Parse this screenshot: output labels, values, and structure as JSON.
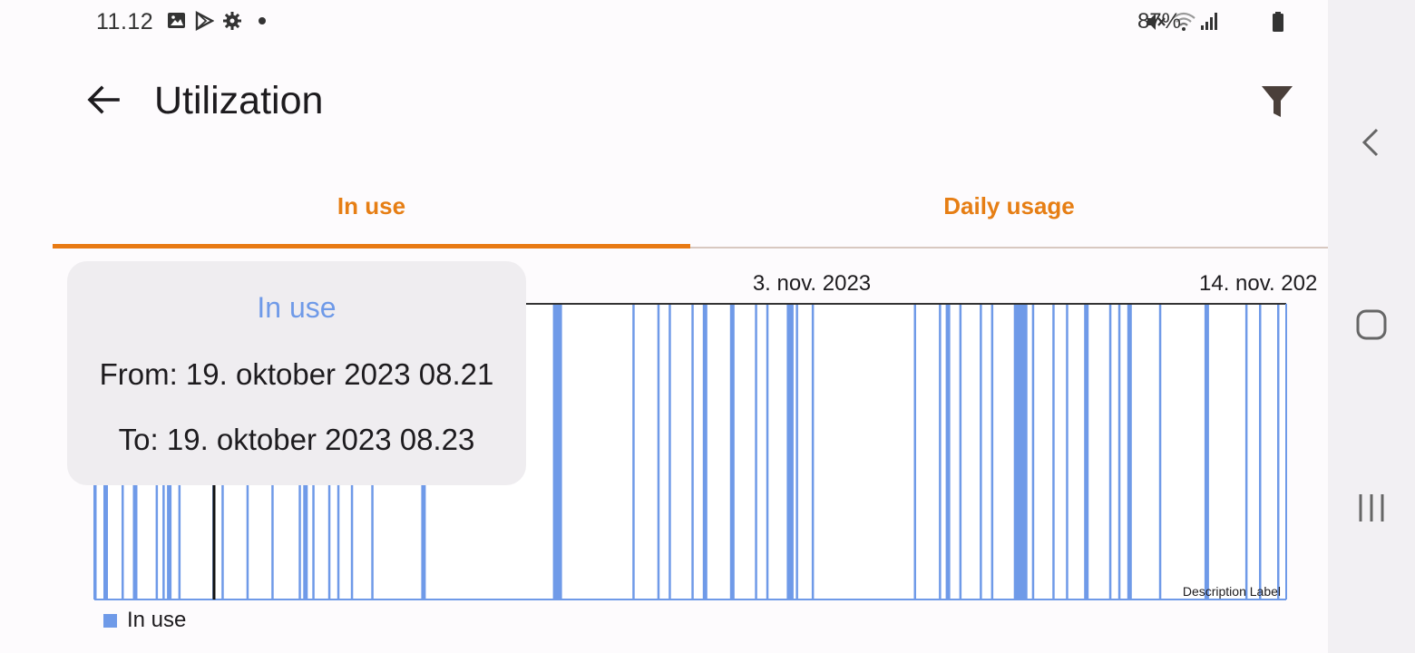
{
  "status": {
    "time": "11.12",
    "battery": "87%"
  },
  "header": {
    "title": "Utilization"
  },
  "tabs": [
    {
      "label": "In use"
    },
    {
      "label": "Daily usage"
    }
  ],
  "tooltip": {
    "title": "In use",
    "from": "From: 19. oktober 2023 08.21",
    "to": "To: 19. oktober 2023 08.23"
  },
  "colors": {
    "accent": "#e87a14",
    "series": "#6f9ae8",
    "tooltip_bg": "#efedf0"
  },
  "chart_data": {
    "type": "bar",
    "xticks": [
      "3. nov. 2023",
      "14. nov. 202"
    ],
    "legend": [
      {
        "name": "In use",
        "color": "#6f9ae8"
      }
    ],
    "description_label": "Description Label",
    "series": [
      {
        "name": "In use",
        "bars": [
          [
            0,
            1
          ],
          [
            4,
            2
          ],
          [
            12,
            1
          ],
          [
            17,
            2
          ],
          [
            27,
            1
          ],
          [
            30,
            1
          ],
          [
            32,
            2
          ],
          [
            37,
            1
          ],
          [
            52,
            1
          ],
          [
            56,
            1
          ],
          [
            67,
            1
          ],
          [
            78,
            1
          ],
          [
            90,
            1
          ],
          [
            92,
            2
          ],
          [
            96,
            1
          ],
          [
            103,
            1
          ],
          [
            107,
            1
          ],
          [
            113,
            1
          ],
          [
            122,
            1
          ],
          [
            144,
            2
          ],
          [
            202,
            4
          ],
          [
            237,
            1
          ],
          [
            248,
            1
          ],
          [
            253,
            1
          ],
          [
            263,
            1
          ],
          [
            268,
            2
          ],
          [
            280,
            2
          ],
          [
            291,
            1
          ],
          [
            296,
            1
          ],
          [
            305,
            3
          ],
          [
            309,
            1
          ],
          [
            316,
            1
          ],
          [
            361,
            1
          ],
          [
            372,
            1
          ],
          [
            375,
            2
          ],
          [
            381,
            1
          ],
          [
            390,
            1
          ],
          [
            395,
            1
          ],
          [
            405,
            6
          ],
          [
            413,
            1
          ],
          [
            422,
            1
          ],
          [
            428,
            1
          ],
          [
            436,
            2
          ],
          [
            447,
            1
          ],
          [
            451,
            1
          ],
          [
            455,
            2
          ],
          [
            469,
            1
          ],
          [
            489,
            2
          ],
          [
            507,
            1
          ],
          [
            513,
            1
          ],
          [
            521,
            1
          ]
        ]
      }
    ]
  }
}
